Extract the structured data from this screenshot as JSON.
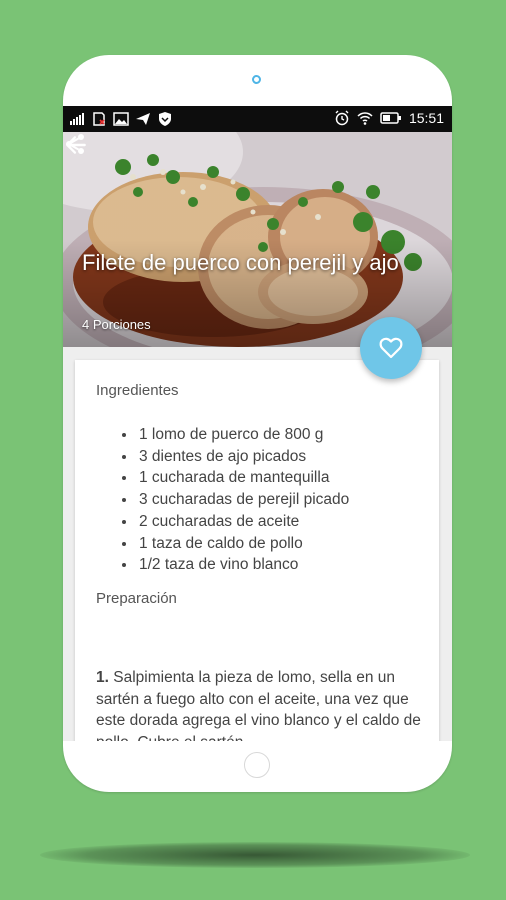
{
  "status_bar": {
    "time": "15:51",
    "left_icons": [
      "signal-icon",
      "no-sim-icon",
      "image-icon",
      "send-icon",
      "shield-icon"
    ],
    "right_icons": [
      "alarm-icon",
      "wifi-icon",
      "battery-icon"
    ]
  },
  "recipe": {
    "title": "Filete de puerco con perejil y ajo",
    "servings": "4 Porciones",
    "ingredients_heading": "Ingredientes",
    "ingredients": [
      "1 lomo de puerco de 800 g",
      "3 dientes de ajo picados",
      "1 cucharada de mantequilla",
      "3 cucharadas de perejil picado",
      "2 cucharadas de aceite",
      "1 taza de caldo de pollo",
      "1/2 taza de vino blanco"
    ],
    "preparation_heading": "Preparación",
    "step_number": "1.",
    "step_text": "Salpimienta la pieza de lomo, sella en un sartén a fuego alto con el aceite, una vez que este dorada agrega el vino blanco y el caldo de pollo. Cubre el sartén"
  },
  "actions": {
    "back_icon": "arrow-back-icon",
    "share_icon": "share-icon",
    "favorite_icon": "heart-outline-icon"
  },
  "colors": {
    "background": "#7ac375",
    "fab": "#6fc6e8",
    "status_bar": "#0d0d0d"
  }
}
